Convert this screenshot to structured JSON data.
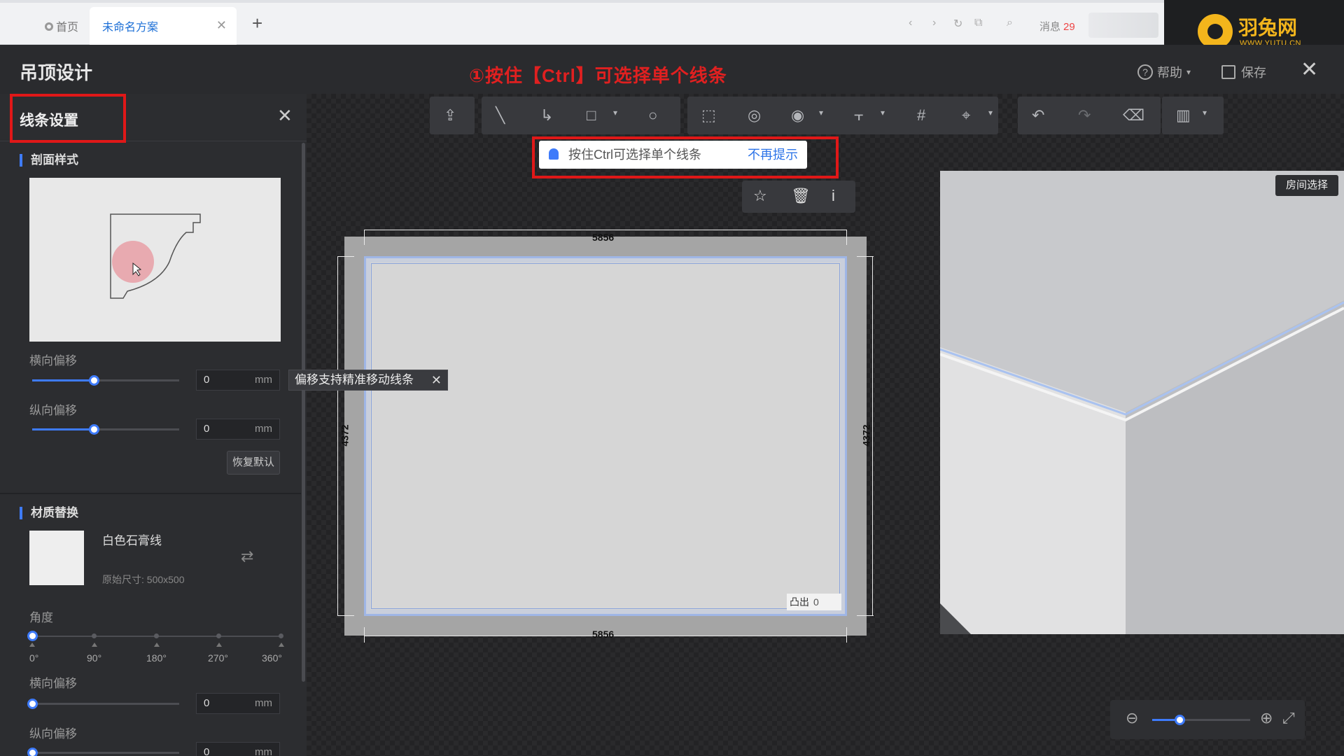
{
  "browser": {
    "home_tab": "首页",
    "active_tab": "未命名方案",
    "message_label": "消息",
    "message_count": "29"
  },
  "logo": {
    "name": "羽兔网",
    "domain": "WWW.YUTU.CN"
  },
  "header": {
    "title": "吊顶设计",
    "annotation": "①按住【Ctrl】可选择单个线条",
    "help": "帮助",
    "save": "保存"
  },
  "panel": {
    "title": "线条设置",
    "section_profile": "剖面样式",
    "h_offset_label": "横向偏移",
    "h_offset_value": "0",
    "v_offset_label": "纵向偏移",
    "v_offset_value": "0",
    "unit": "mm",
    "reset_label": "恢复默认",
    "h_offset_fraction": 0.42,
    "v_offset_fraction": 0.42,
    "section_material": "材质替换",
    "material_name": "白色石膏线",
    "material_size": "原始尺寸: 500x500",
    "angle_label": "角度",
    "angle_ticks": [
      "0°",
      "90°",
      "180°",
      "270°",
      "360°"
    ],
    "angle_value": 0,
    "mat_h_offset_label": "横向偏移",
    "mat_h_offset_value": "0",
    "mat_v_offset_label": "纵向偏移",
    "mat_v_offset_value": "0"
  },
  "tooltip": {
    "text": "偏移支持精准移动线条"
  },
  "hint": {
    "text": "按住Ctrl可选择单个线条",
    "dismiss": "不再提示"
  },
  "plan": {
    "width_top": "5856",
    "width_bottom": "5856",
    "height_left": "4372",
    "height_right": "4372",
    "protrude_label": "凸出",
    "protrude_value": "0"
  },
  "preview": {
    "room_select": "房间选择"
  },
  "zoom": {
    "level_fraction": 0.28
  },
  "colors": {
    "accent": "#3e7bfa",
    "highlight_red": "#e01818",
    "link": "#2d74e8",
    "logo": "#f3b51c"
  }
}
